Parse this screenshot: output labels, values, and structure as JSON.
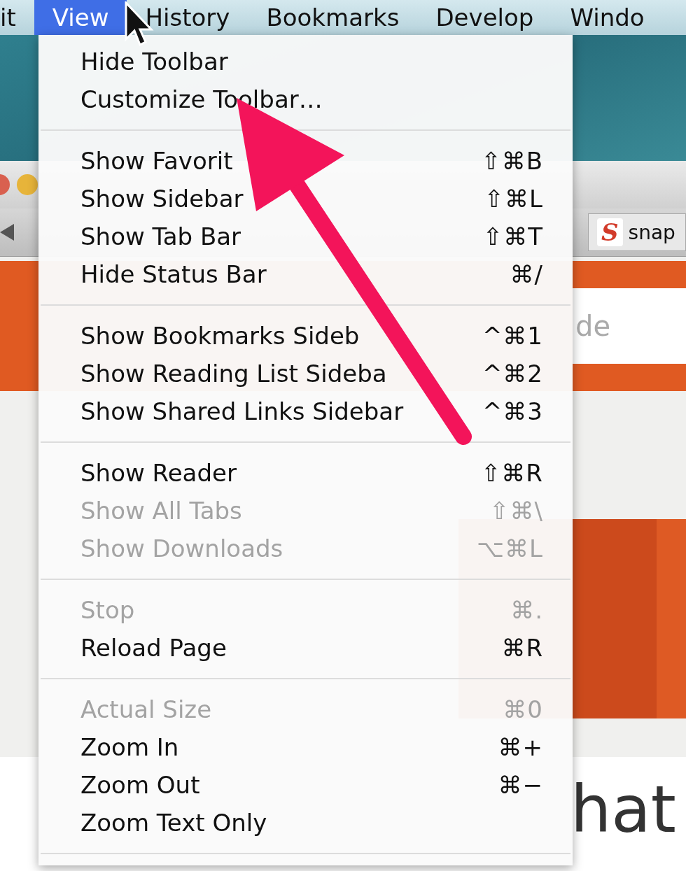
{
  "menubar": {
    "items": [
      {
        "label": "it",
        "selected": false
      },
      {
        "label": "View",
        "selected": true
      },
      {
        "label": "History",
        "selected": false
      },
      {
        "label": "Bookmarks",
        "selected": false
      },
      {
        "label": "Develop",
        "selected": false
      },
      {
        "label": "Windo",
        "selected": false
      }
    ]
  },
  "menu": {
    "sections": [
      [
        {
          "label": "Hide Toolbar",
          "disabled": false
        },
        {
          "label": "Customize Toolbar…",
          "disabled": false
        }
      ],
      [
        {
          "label": "Show Favorit",
          "shortcut": "⇧⌘B",
          "disabled": false
        },
        {
          "label": "Show Sidebar",
          "shortcut": "⇧⌘L",
          "disabled": false
        },
        {
          "label": "Show Tab Bar",
          "shortcut": "⇧⌘T",
          "disabled": false
        },
        {
          "label": "Hide Status Bar",
          "shortcut": "⌘/",
          "disabled": false
        }
      ],
      [
        {
          "label": "Show Bookmarks Sideb",
          "shortcut": "^⌘1",
          "disabled": false
        },
        {
          "label": "Show Reading List Sideba",
          "shortcut": "^⌘2",
          "disabled": false
        },
        {
          "label": "Show Shared Links Sidebar",
          "shortcut": "^⌘3",
          "disabled": false
        }
      ],
      [
        {
          "label": "Show Reader",
          "shortcut": "⇧⌘R",
          "disabled": false
        },
        {
          "label": "Show All Tabs",
          "shortcut": "⇧⌘\\",
          "disabled": true
        },
        {
          "label": "Show Downloads",
          "shortcut": "⌥⌘L",
          "disabled": true
        }
      ],
      [
        {
          "label": "Stop",
          "shortcut": "⌘.",
          "disabled": true
        },
        {
          "label": "Reload Page",
          "shortcut": "⌘R",
          "disabled": false
        }
      ],
      [
        {
          "label": "Actual Size",
          "shortcut": "⌘0",
          "disabled": true
        },
        {
          "label": "Zoom In",
          "shortcut": "⌘+",
          "disabled": false
        },
        {
          "label": "Zoom Out",
          "shortcut": "⌘−",
          "disabled": false
        },
        {
          "label": "Zoom Text Only",
          "disabled": false
        }
      ]
    ]
  },
  "browser": {
    "tab": {
      "logo": "S",
      "label": "snap"
    },
    "search": {
      "placeholder": "de"
    },
    "heading": "hat"
  }
}
